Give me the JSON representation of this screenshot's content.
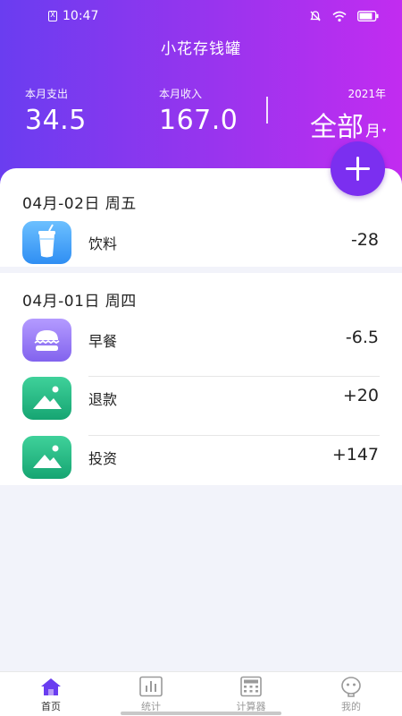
{
  "status_bar": {
    "time": "10:47",
    "sim": "X",
    "battery_percent": 85
  },
  "app": {
    "title": "小花存钱罐"
  },
  "summary": {
    "expense_label": "本月支出",
    "expense_value": "34.5",
    "income_label": "本月收入",
    "income_value": "167.0",
    "year": "2021年",
    "range_all": "全部",
    "range_unit": "月",
    "range_caret": "▾"
  },
  "days": [
    {
      "date": "04月-02日 周五",
      "items": [
        {
          "label": "饮料",
          "amount": "-28",
          "icon": "drink-cup-icon",
          "color": "#3d98f5"
        }
      ]
    },
    {
      "date": "04月-01日 周四",
      "items": [
        {
          "label": "早餐",
          "amount": "-6.5",
          "icon": "burger-icon",
          "color": "#8f72f2"
        },
        {
          "label": "退款",
          "amount": "+20",
          "icon": "mountain-image-icon",
          "color": "#21b07c"
        },
        {
          "label": "投资",
          "amount": "+147",
          "icon": "mountain-image-icon",
          "color": "#21b07c"
        }
      ]
    }
  ],
  "tabbar": {
    "tabs": [
      {
        "label": "首页",
        "icon": "home-icon",
        "active": true
      },
      {
        "label": "统计",
        "icon": "bar-chart-icon",
        "active": false
      },
      {
        "label": "计算器",
        "icon": "calculator-icon",
        "active": false
      },
      {
        "label": "我的",
        "icon": "profile-face-icon",
        "active": false
      }
    ]
  },
  "colors": {
    "header_start": "#6a3df0",
    "header_end": "#c22cf0",
    "accent": "#7b2ff0",
    "tab_active": "#6a3df0"
  }
}
